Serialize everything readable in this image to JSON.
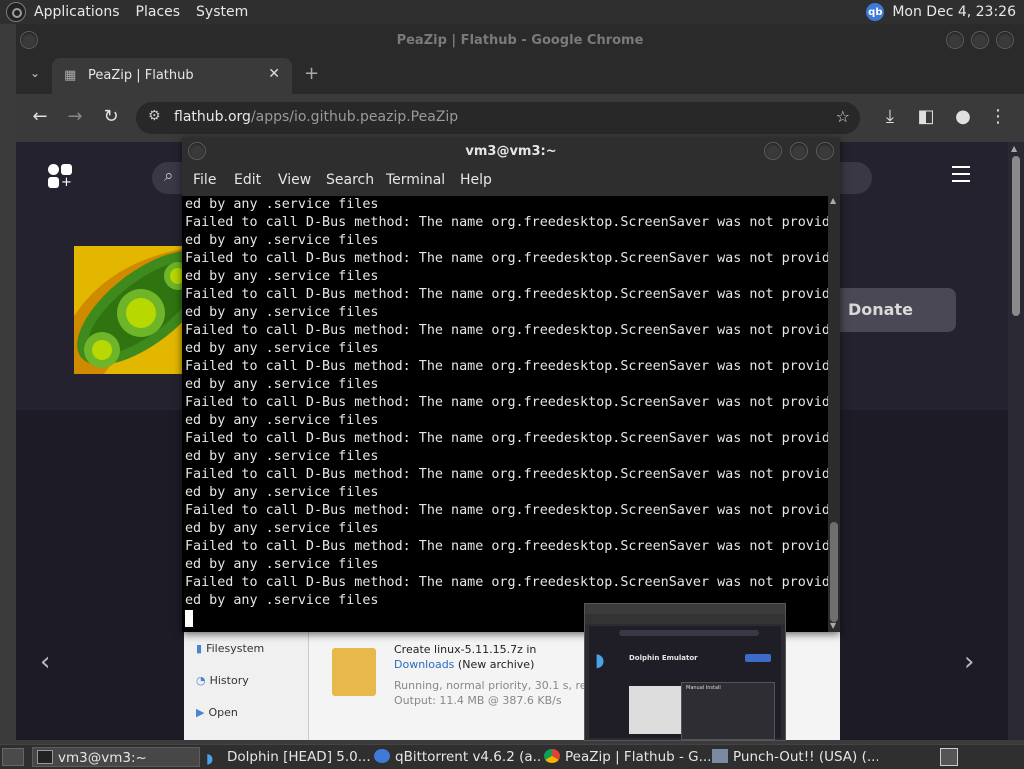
{
  "top_panel": {
    "menus": [
      "Applications",
      "Places",
      "System"
    ],
    "tray_icon": "qbittorrent-icon",
    "tray_label": "qb",
    "clock": "Mon Dec  4, 23:26"
  },
  "browser": {
    "window_title": "PeaZip | Flathub - Google Chrome",
    "tab_title": "PeaZip | Flathub",
    "url_host": "flathub.org",
    "url_path": "/apps/io.github.peazip.PeaZip",
    "page": {
      "donate_label": "Donate",
      "screenshot": {
        "sidebar_items": [
          "Filesystem",
          "History",
          "Open"
        ],
        "detail_title": "Create linux-5.11.15.7z in",
        "detail_link": "Downloads",
        "detail_link_suffix": " (New archive)",
        "detail_status": "Running, normal priority, 30.1 s, remain",
        "detail_output": "Output: 11.4 MB @ 387.6 KB/s"
      }
    }
  },
  "terminal": {
    "title": "vm3@vm3:~",
    "menus": [
      "File",
      "Edit",
      "View",
      "Search",
      "Terminal",
      "Help"
    ],
    "lines": [
      "ed by any .service files",
      "Failed to call D-Bus method: The name org.freedesktop.ScreenSaver was not provid",
      "ed by any .service files",
      "Failed to call D-Bus method: The name org.freedesktop.ScreenSaver was not provid",
      "ed by any .service files",
      "Failed to call D-Bus method: The name org.freedesktop.ScreenSaver was not provid",
      "ed by any .service files",
      "Failed to call D-Bus method: The name org.freedesktop.ScreenSaver was not provid",
      "ed by any .service files",
      "Failed to call D-Bus method: The name org.freedesktop.ScreenSaver was not provid",
      "ed by any .service files",
      "Failed to call D-Bus method: The name org.freedesktop.ScreenSaver was not provid",
      "ed by any .service files",
      "Failed to call D-Bus method: The name org.freedesktop.ScreenSaver was not provid",
      "ed by any .service files",
      "Failed to call D-Bus method: The name org.freedesktop.ScreenSaver was not provid",
      "ed by any .service files",
      "Failed to call D-Bus method: The name org.freedesktop.ScreenSaver was not provid",
      "ed by any .service files",
      "Failed to call D-Bus method: The name org.freedesktop.ScreenSaver was not provid",
      "ed by any .service files",
      "Failed to call D-Bus method: The name org.freedesktop.ScreenSaver was not provid",
      "ed by any .service files"
    ]
  },
  "preview": {
    "title": "Dolphin Emulator",
    "dialog_title": "Manual Install"
  },
  "taskbar": {
    "tasks": [
      {
        "label": "vm3@vm3:~",
        "icon": "terminal-icon"
      },
      {
        "label": "Dolphin [HEAD] 5.0...",
        "icon": "dolphin-icon"
      },
      {
        "label": "qBittorrent v4.6.2 (a...",
        "icon": "qbittorrent-icon"
      },
      {
        "label": "PeaZip | Flathub - G...",
        "icon": "chrome-icon"
      },
      {
        "label": "Punch-Out!! (USA) (...",
        "icon": "emulator-icon"
      }
    ]
  }
}
